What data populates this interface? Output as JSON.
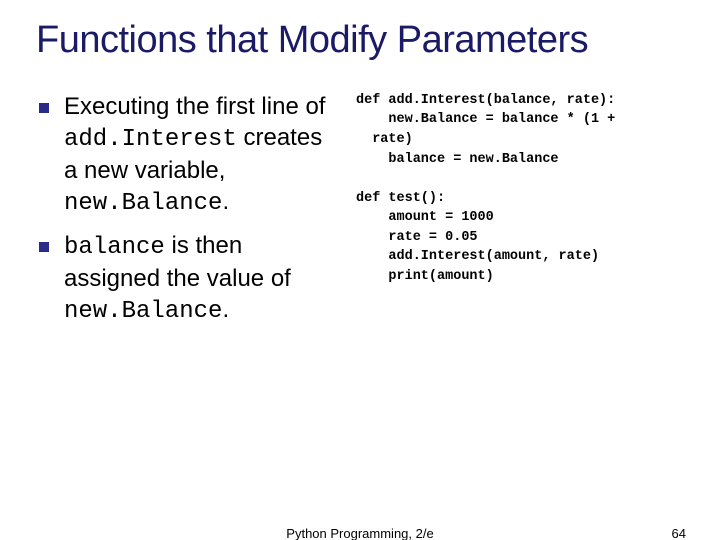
{
  "title": "Functions that Modify Parameters",
  "bullets": [
    {
      "pre": "Executing the first line of ",
      "code1": "add.Interest",
      "mid": " creates a new variable, ",
      "code2": "new.Balance",
      "post": "."
    },
    {
      "code1": "balance",
      "mid": " is then assigned the value of ",
      "code2": "new.Balance",
      "post": "."
    }
  ],
  "code": "def add.Interest(balance, rate):\n    new.Balance = balance * (1 +\n  rate)\n    balance = new.Balance\n\ndef test():\n    amount = 1000\n    rate = 0.05\n    add.Interest(amount, rate)\n    print(amount)",
  "footer": {
    "center": "Python Programming, 2/e",
    "page": "64"
  }
}
